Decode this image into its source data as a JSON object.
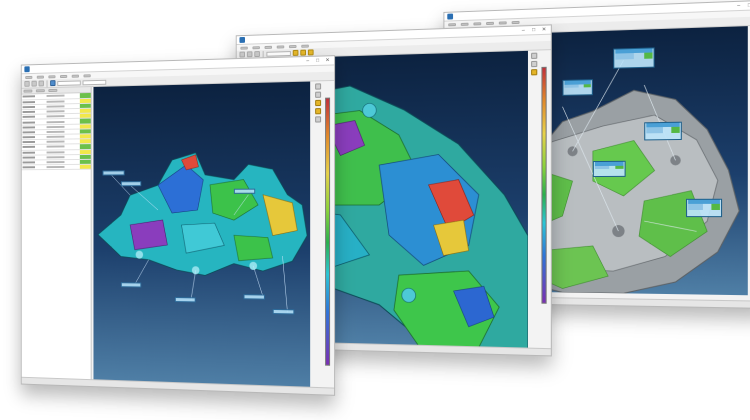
{
  "colors": {
    "background": "#ffffff",
    "viewport_top": "#0c2240",
    "viewport_bottom": "#4f7fa6",
    "deviation_high": "#c2303a",
    "deviation_mid": "#2bb04d",
    "deviation_low": "#7a2fb3",
    "accent": "#e6b82a",
    "pass": "#6cc04a",
    "warn": "#f2e84a"
  },
  "icons": {
    "app": "app-logo-icon",
    "minimize": "minimize-icon",
    "maximize": "maximize-icon",
    "close": "close-icon"
  },
  "windows": {
    "back": {
      "glyph_min": "–",
      "glyph_max": "□",
      "glyph_close": "✕"
    },
    "mid": {
      "glyph_min": "–",
      "glyph_max": "□",
      "glyph_close": "✕"
    },
    "front": {
      "glyph_min": "–",
      "glyph_max": "□",
      "glyph_close": "✕"
    }
  }
}
